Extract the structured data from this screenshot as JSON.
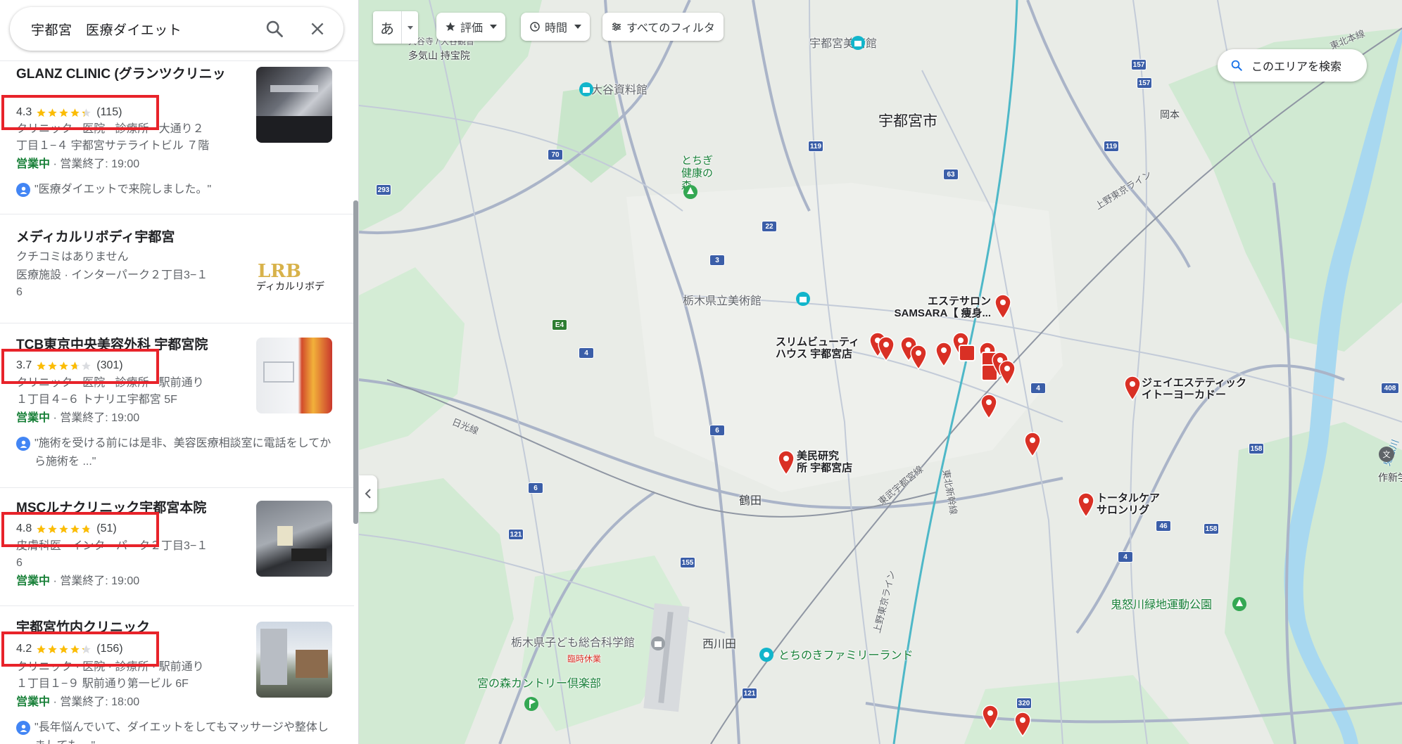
{
  "search": {
    "query": "宇都宮　医療ダイエット"
  },
  "results": [
    {
      "title": "GLANZ CLINIC (グランツクリニック)",
      "rating": "4.3",
      "stars": 4.3,
      "count": "(115)",
      "line1": "クリニック · 医院 · 診療所 · 大通り２",
      "line2": "丁目１−４ 宇都宮サテライトビル ７階",
      "open": "営業中",
      "close": " · 営業終了: 19:00",
      "review": "\"医療ダイエットで来院しました。\""
    },
    {
      "title": "メディカルリボディ宇都宮",
      "no_reviews": "クチコミはありません",
      "line1": "医療施設 · インターパーク２丁目3−１",
      "line2": "6",
      "thumb_text": "ディカルリボデ"
    },
    {
      "title": "TCB東京中央美容外科 宇都宮院",
      "rating": "3.7",
      "stars": 3.7,
      "count": "(301)",
      "line1": "クリニック · 医院 · 診療所 · 駅前通り",
      "line2": "１丁目４−６ トナリエ宇都宮 5F",
      "open": "営業中",
      "close": " · 営業終了: 19:00",
      "review": "\"施術を受ける前には是非、美容医療相談室に電話をしてから施術を ...\""
    },
    {
      "title": "MSCルナクリニック宇都宮本院",
      "rating": "4.8",
      "stars": 4.8,
      "count": "(51)",
      "line1": "皮膚科医 · インターパーク２丁目3−１",
      "line2": "6",
      "open": "営業中",
      "close": " · 営業終了: 19:00"
    },
    {
      "title": "宇都宮竹内クリニック",
      "rating": "4.2",
      "stars": 4.2,
      "count": "(156)",
      "line1": "クリニック · 医院 · 診療所 · 駅前通り",
      "line2": "１丁目１−９ 駅前通り第一ビル 6F",
      "open": "営業中",
      "close": " · 営業終了: 18:00",
      "review": "\"長年悩んでいて、ダイエットをしてもマッサージや整体しましても ...\""
    }
  ],
  "map": {
    "lang": "あ",
    "chips": {
      "rating": "評価",
      "hours": "時間",
      "filters": "すべてのフィルタ"
    },
    "search_area": "このエリアを検索",
    "labels": {
      "city": "宇都宮市",
      "museum_city": "宇都宮美術館",
      "oya": "大谷資料館",
      "tochigi_forest": "とちぎ健康の森",
      "tochigi_art": "栃木県立美術館",
      "tsuruta": "鶴田",
      "nishikawada": "西川田",
      "kids_hospital": "栃木県子ども総合科学館",
      "kids_sub": "臨時休業",
      "family_land": "とちのきファミリーランド",
      "miyanomori": "宮の森カントリー倶楽部",
      "kinugawa_park": "鬼怒川緑地運動公園",
      "okamoto": "岡本",
      "sakushin": "作新学院",
      "tohoku_main": "東北本線",
      "joban": "上野東京ライン",
      "nikko": "日光線",
      "tobu": "東武宇都宮線",
      "shinkansen": "東北新幹線",
      "ueno2": "上野東京ライン",
      "kinugawa": "鬼怒川",
      "tokuei": "多気山 持宝院",
      "oya_temple": "大谷寺 / 大谷観音"
    },
    "pins": {
      "esthe1": "エステサロン",
      "esthe2": "SAMSARA【 痩身...",
      "slim1": "スリムビューティ",
      "slim2": "ハウス 宇都宮店",
      "je1": "ジェイエステティック",
      "je2": "イトーヨーカドー",
      "bimin1": "美民研究",
      "bimin2": "所 宇都宮店",
      "total1": "トータルケア",
      "total2": "サロンリグ"
    },
    "road_numbers": [
      "157",
      "157",
      "119",
      "70",
      "293",
      "22",
      "3",
      "4",
      "E4",
      "6",
      "6",
      "121",
      "155",
      "121",
      "119",
      "63",
      "4",
      "46",
      "158",
      "408",
      "158",
      "320",
      "4"
    ]
  }
}
